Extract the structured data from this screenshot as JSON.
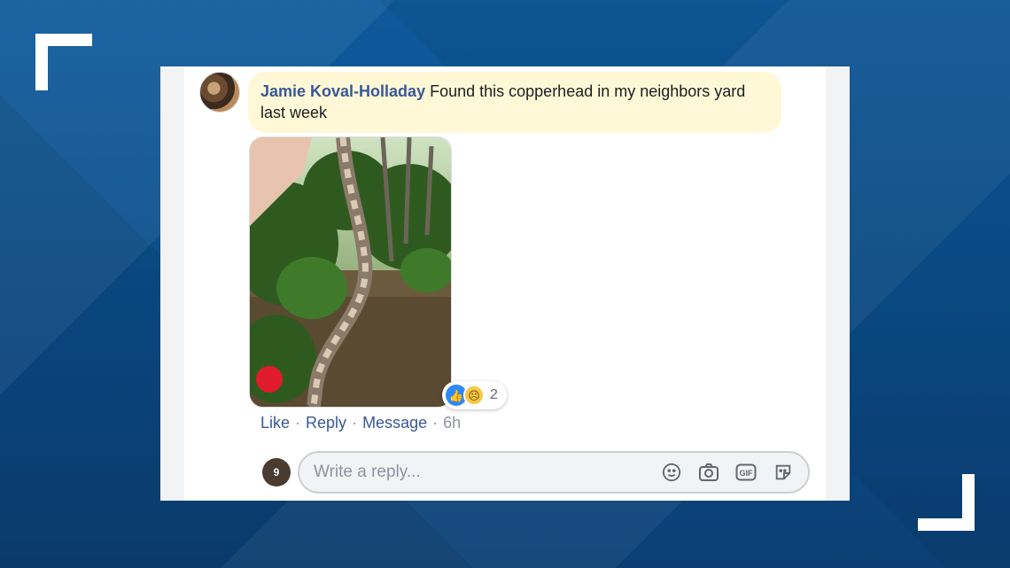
{
  "comment": {
    "author": "Jamie Koval-Holladay",
    "text": "Found this copperhead in my neighbors yard last week"
  },
  "reactions": {
    "icons": [
      "like-icon",
      "sad-icon"
    ],
    "count": "2"
  },
  "actions": {
    "like": "Like",
    "reply": "Reply",
    "message": "Message",
    "separator": "·",
    "time": "6h"
  },
  "reply_box": {
    "avatar_label": "9",
    "placeholder": "Write a reply...",
    "tools": [
      "emoji-icon",
      "camera-icon",
      "gif-icon",
      "sticker-icon"
    ],
    "gif_label": "GIF"
  },
  "colors": {
    "author_link": "#385898",
    "bubble_bg": "#fff8d6",
    "like_blue": "#2d88ff"
  }
}
